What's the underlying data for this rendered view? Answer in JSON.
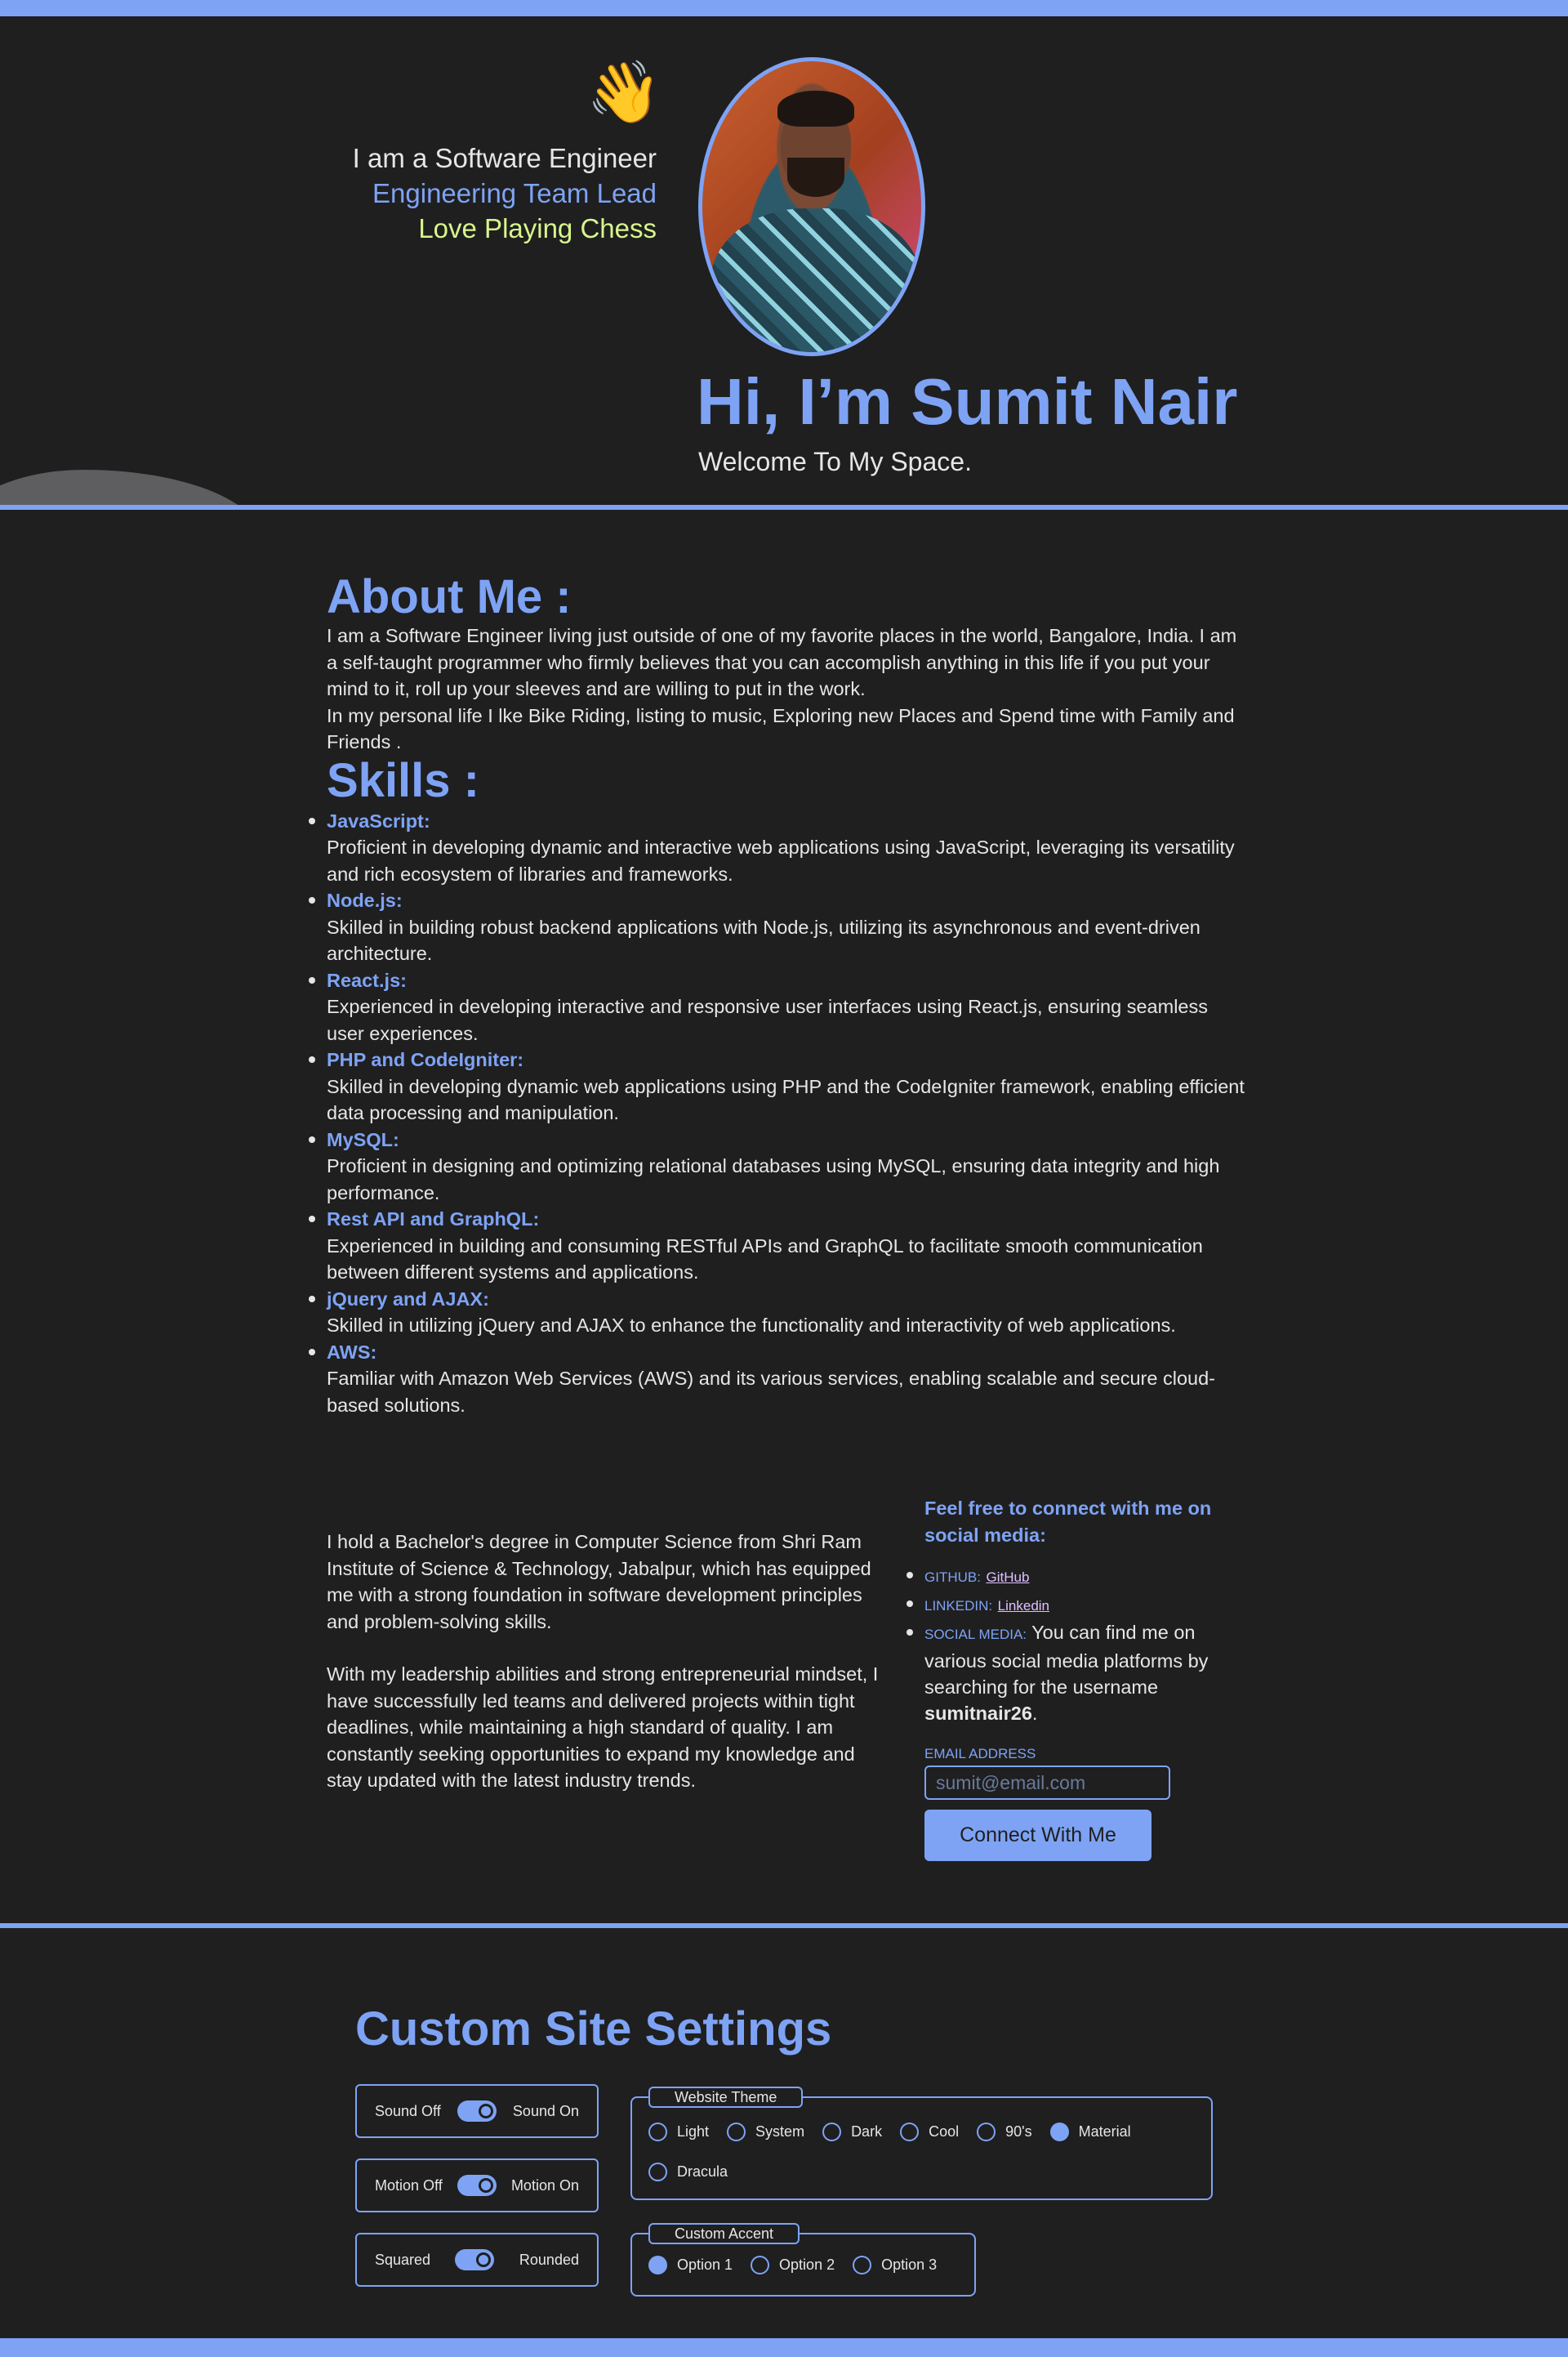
{
  "hero": {
    "wave_emoji": "👋",
    "roles": [
      "I am a Software Engineer",
      "Engineering Team Lead",
      "Love Playing Chess"
    ],
    "greeting": "Hi, I’m Sumit Nair",
    "welcome": "Welcome To My Space."
  },
  "about": {
    "title": "About Me :",
    "paragraph_1": "I am a Software Engineer living just outside of one of my favorite places in the world, Bangalore, India. I am a self-taught programmer who firmly believes that you can accomplish anything in this life if you put your mind to it, roll up your sleeves and are willing to put in the work.",
    "paragraph_2": "In my personal life I lke Bike Riding, listing to music, Exploring new Places and Spend time with Family and Friends ."
  },
  "skills": {
    "title": "Skills :",
    "items": [
      {
        "name": "JavaScript:",
        "desc": "Proficient in developing dynamic and interactive web applications using JavaScript, leveraging its versatility and rich ecosystem of libraries and frameworks."
      },
      {
        "name": "Node.js:",
        "desc": "Skilled in building robust backend applications with Node.js, utilizing its asynchronous and event-driven architecture."
      },
      {
        "name": "React.js:",
        "desc": "Experienced in developing interactive and responsive user interfaces using React.js, ensuring seamless user experiences."
      },
      {
        "name": "PHP and CodeIgniter:",
        "desc": "Skilled in developing dynamic web applications using PHP and the CodeIgniter framework, enabling efficient data processing and manipulation."
      },
      {
        "name": "MySQL:",
        "desc": "Proficient in designing and optimizing relational databases using MySQL, ensuring data integrity and high performance."
      },
      {
        "name": "Rest API and GraphQL:",
        "desc": "Experienced in building and consuming RESTful APIs and GraphQL to facilitate smooth communication between different systems and applications."
      },
      {
        "name": "jQuery and AJAX:",
        "desc": "Skilled in utilizing jQuery and AJAX to enhance the functionality and interactivity of web applications."
      },
      {
        "name": "AWS:",
        "desc": "Familiar with Amazon Web Services (AWS) and its various services, enabling scalable and secure cloud-based solutions."
      }
    ]
  },
  "education": {
    "paragraph_1": "I hold a Bachelor's degree in Computer Science from Shri Ram Institute of Science & Technology, Jabalpur, which has equipped me with a strong foundation in software development principles and problem-solving skills.",
    "paragraph_2": "With my leadership abilities and strong entrepreneurial mindset, I have successfully led teams and delivered projects within tight deadlines, while maintaining a high standard of quality. I am constantly seeking opportunities to expand my knowledge and stay updated with the latest industry trends."
  },
  "connect": {
    "title": "Feel free to connect with me on social media:",
    "github_label": "GITHUB:",
    "github_link": "GitHub",
    "linkedin_label": "LINKEDIN:",
    "linkedin_link": "Linkedin",
    "social_label": "SOCIAL MEDIA:",
    "social_text": "You can find me on various social media platforms by searching for the username",
    "username": "sumitnair26",
    "username_suffix": ".",
    "email_label": "EMAIL ADDRESS",
    "email_placeholder": "sumit@email.com",
    "button": "Connect With Me"
  },
  "settings": {
    "title": "Custom Site Settings",
    "toggles": [
      {
        "off": "Sound Off",
        "on": "Sound On",
        "state": "on"
      },
      {
        "off": "Motion Off",
        "on": "Motion On",
        "state": "on"
      },
      {
        "off": "Squared",
        "on": "Rounded",
        "state": "on"
      }
    ],
    "theme": {
      "legend": "Website Theme",
      "options": [
        "Light",
        "System",
        "Dark",
        "Cool",
        "90's",
        "Material",
        "Dracula"
      ],
      "selected": "Material"
    },
    "accent": {
      "legend": "Custom Accent",
      "options": [
        "Option 1",
        "Option 2",
        "Option 3"
      ],
      "selected": "Option 1"
    }
  },
  "colors": {
    "accent": "#7ea3f4",
    "background": "#1f1f20",
    "text": "#e6e6e6",
    "highlight_green": "#d8f58c",
    "link": "#e0c0ff"
  },
  "icons": [
    "waving-hand-icon"
  ]
}
